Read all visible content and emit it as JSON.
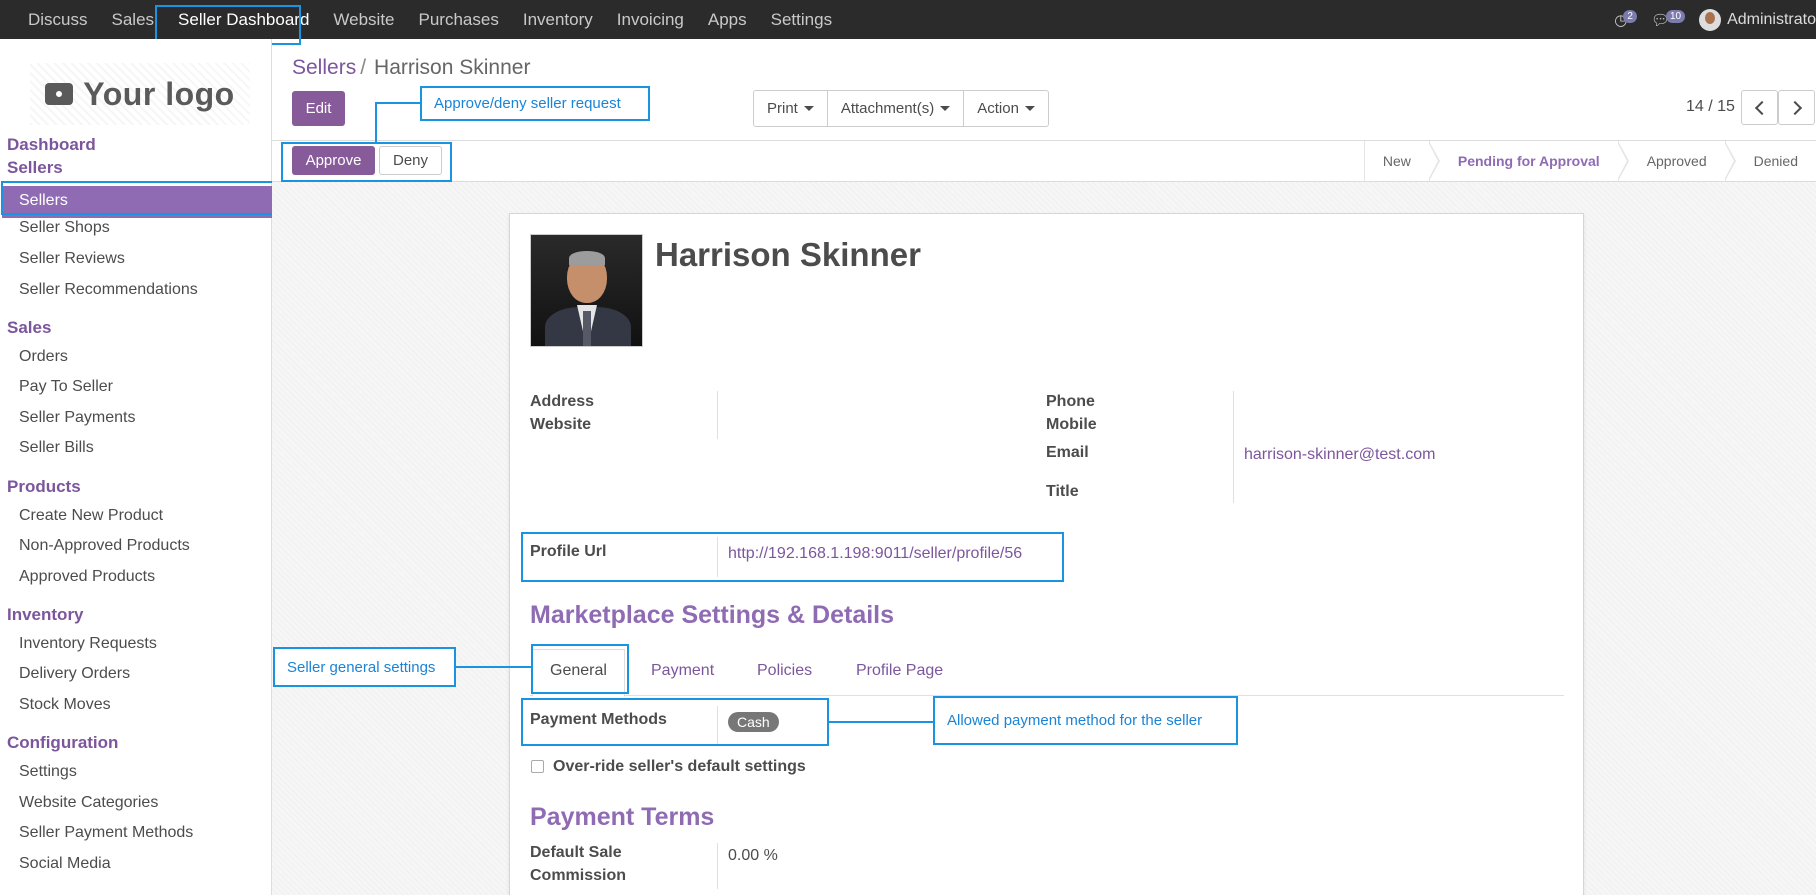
{
  "topnav": {
    "items": [
      "Discuss",
      "Sales",
      "Seller Dashboard",
      "Website",
      "Purchases",
      "Inventory",
      "Invoicing",
      "Apps",
      "Settings"
    ],
    "active": "Seller Dashboard",
    "activity_count": "2",
    "message_count": "10",
    "user": "Administrato"
  },
  "sidebar": {
    "logo_text": "Your logo",
    "dashboard": "Dashboard",
    "sections": [
      {
        "title": "Sellers",
        "items": [
          "Sellers",
          "Seller Shops",
          "Seller Reviews",
          "Seller Recommendations"
        ]
      },
      {
        "title": "Sales",
        "items": [
          "Orders",
          "Pay To Seller",
          "Seller Payments",
          "Seller Bills"
        ]
      },
      {
        "title": "Products",
        "items": [
          "Create New Product",
          "Non-Approved Products",
          "Approved Products"
        ]
      },
      {
        "title": "Inventory",
        "items": [
          "Inventory Requests",
          "Delivery Orders",
          "Stock Moves"
        ]
      },
      {
        "title": "Configuration",
        "items": [
          "Settings",
          "Website Categories",
          "Seller Payment Methods",
          "Social Media"
        ]
      }
    ]
  },
  "breadcrumb": {
    "parent": "Sellers",
    "separator": "/",
    "current": "Harrison Skinner"
  },
  "toolbar": {
    "edit": "Edit",
    "print": "Print",
    "attachments": "Attachment(s)",
    "action": "Action",
    "pager": "14 / 15"
  },
  "statusbar": {
    "approve": "Approve",
    "deny": "Deny",
    "stages": [
      "New",
      "Pending for Approval",
      "Approved",
      "Denied"
    ],
    "active_stage": "Pending for Approval"
  },
  "record": {
    "name": "Harrison Skinner",
    "address_label": "Address",
    "website_label": "Website",
    "phone_label": "Phone",
    "mobile_label": "Mobile",
    "email_label": "Email",
    "email": "harrison-skinner@test.com",
    "title_label": "Title",
    "profile_url_label": "Profile Url",
    "profile_url": "http://192.168.1.198:9011/seller/profile/56",
    "marketplace_title": "Marketplace Settings & Details",
    "tabs": [
      "General",
      "Payment",
      "Policies",
      "Profile Page"
    ],
    "payment_methods_label": "Payment Methods",
    "payment_method": "Cash",
    "override_label": "Over-ride seller's default settings",
    "payment_terms_title": "Payment Terms",
    "commission_label_1": "Default Sale",
    "commission_label_2": "Commission",
    "commission_value": "0.00 %"
  },
  "annotations": {
    "approve_deny": "Approve/deny seller request",
    "general_settings": "Seller general settings",
    "payment_method": "Allowed payment method for the seller"
  },
  "colors": {
    "brand": "#875a9a",
    "link": "#7c569d",
    "annotation": "#1a94e0",
    "topbar": "#2b2b2b"
  }
}
